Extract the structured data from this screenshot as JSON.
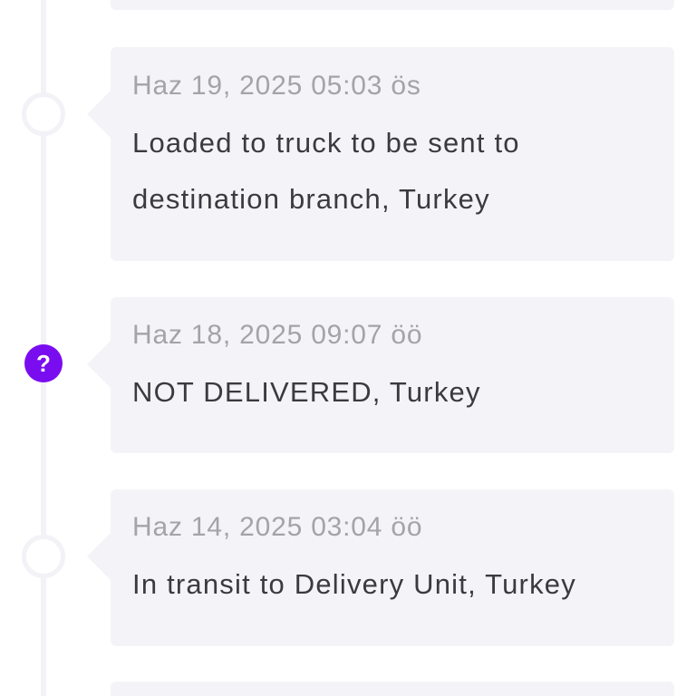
{
  "events": [
    {
      "date": "Haz 19, 2025 05:03 ös",
      "line1": "Loaded to truck to be sent to",
      "line2": "destination branch, Turkey",
      "marker": "circle-icon"
    },
    {
      "date": "Haz 18, 2025 09:07 öö",
      "line1": "NOT DELIVERED, Turkey",
      "marker": "question-icon",
      "marker_glyph": "?",
      "marker_color": "#7a0cf0"
    },
    {
      "date": "Haz 14, 2025 03:04 öö",
      "line1": "In transit to Delivery Unit, Turkey",
      "marker": "circle-icon"
    }
  ],
  "colors": {
    "card_bg": "#f4f4f8",
    "date_text": "#a3a3a8",
    "body_text": "#3a3a40",
    "accent": "#7a0cf0"
  }
}
